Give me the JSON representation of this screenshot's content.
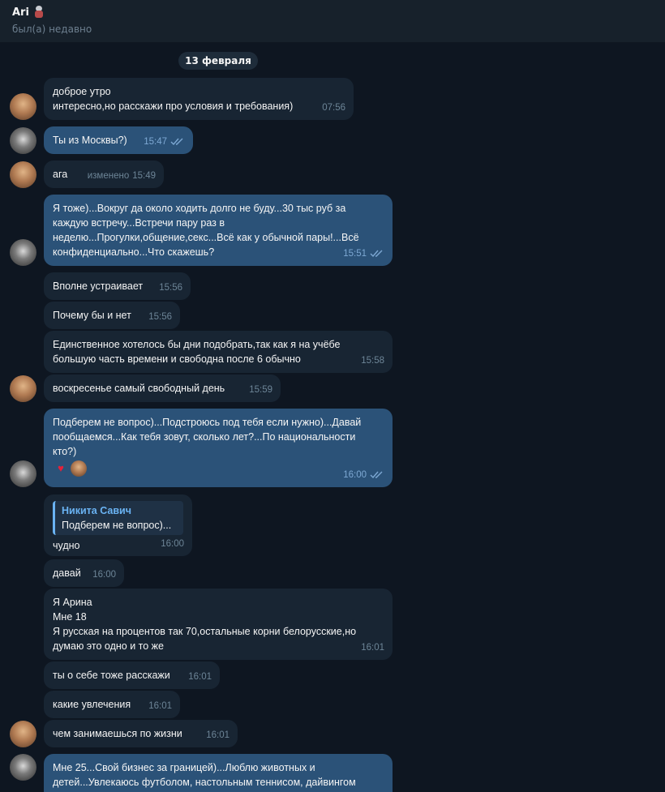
{
  "header": {
    "title": "Ari",
    "title_emoji": "astronaut-emoji",
    "status": "был(а) недавно"
  },
  "date_separator": "13 февраля",
  "messages": [
    {
      "id": "m1",
      "side": "in",
      "text": "доброе утро\nинтересно,но расскажи про условия и требования)",
      "time": "07:56"
    },
    {
      "id": "m2",
      "side": "out",
      "text": "Ты из Москвы?)",
      "time": "15:47",
      "read": true
    },
    {
      "id": "m3",
      "side": "in",
      "text": "ага",
      "time": "15:49",
      "edited": "изменено"
    },
    {
      "id": "m4",
      "side": "out",
      "text": "Я тоже)...Вокруг да около ходить долго не буду...30 тыс руб за\nкаждую встречу...Встречи пару раз в\nнеделю...Прогулки,общение,секс...Всё как у обычной пары!...Всё\nконфиденциально...Что скажешь?",
      "time": "15:51",
      "read": true
    },
    {
      "id": "m5",
      "side": "in",
      "text": "Вполне устраивает",
      "time": "15:56"
    },
    {
      "id": "m6",
      "side": "in",
      "text": "Почему бы и нет",
      "time": "15:56"
    },
    {
      "id": "m7",
      "side": "in",
      "text": "Единственное хотелось бы дни подобрать,так как я на учёбе\nбольшую часть времени и свободна после 6 обычно",
      "time": "15:58"
    },
    {
      "id": "m8",
      "side": "in",
      "text": "воскресенье самый свободный день",
      "time": "15:59"
    },
    {
      "id": "m9",
      "side": "out",
      "text": "Подберем не вопрос)...Подстроюсь под тебя если нужно)...Давай\nпообщаемся...Как тебя зовут, сколько лет?...По национальности\nкто?)",
      "time": "16:00",
      "read": true,
      "reactions": [
        "heart-reaction-icon",
        "reactor-avatar"
      ]
    },
    {
      "id": "m10",
      "side": "in",
      "reply": {
        "name": "Никита Савич",
        "text": "Подберем не вопрос)..."
      },
      "text": "чудно",
      "time": "16:00"
    },
    {
      "id": "m11",
      "side": "in",
      "text": "давай",
      "time": "16:00"
    },
    {
      "id": "m12",
      "side": "in",
      "text": "Я Арина\nМне 18\nЯ русская на процентов так 70,остальные корни белорусские,но\nдумаю это одно и то же",
      "time": "16:01"
    },
    {
      "id": "m13",
      "side": "in",
      "text": "ты о себе тоже расскажи",
      "time": "16:01"
    },
    {
      "id": "m14",
      "side": "in",
      "text": "какие увлечения",
      "time": "16:01"
    },
    {
      "id": "m15",
      "side": "in",
      "text": "чем занимаешься по жизни",
      "time": "16:01"
    },
    {
      "id": "m16",
      "side": "out",
      "text": "Мне 25...Свой бизнес за границей)...Люблю животных и\nдетей...Увлекаюсь футболом, настольным теннисом, дайвингом",
      "time": ""
    }
  ],
  "colors": {
    "background": "#0e1621",
    "header": "#17212b",
    "incoming_bubble": "#182533",
    "outgoing_bubble": "#2b5278",
    "accent": "#6ab3f3"
  }
}
